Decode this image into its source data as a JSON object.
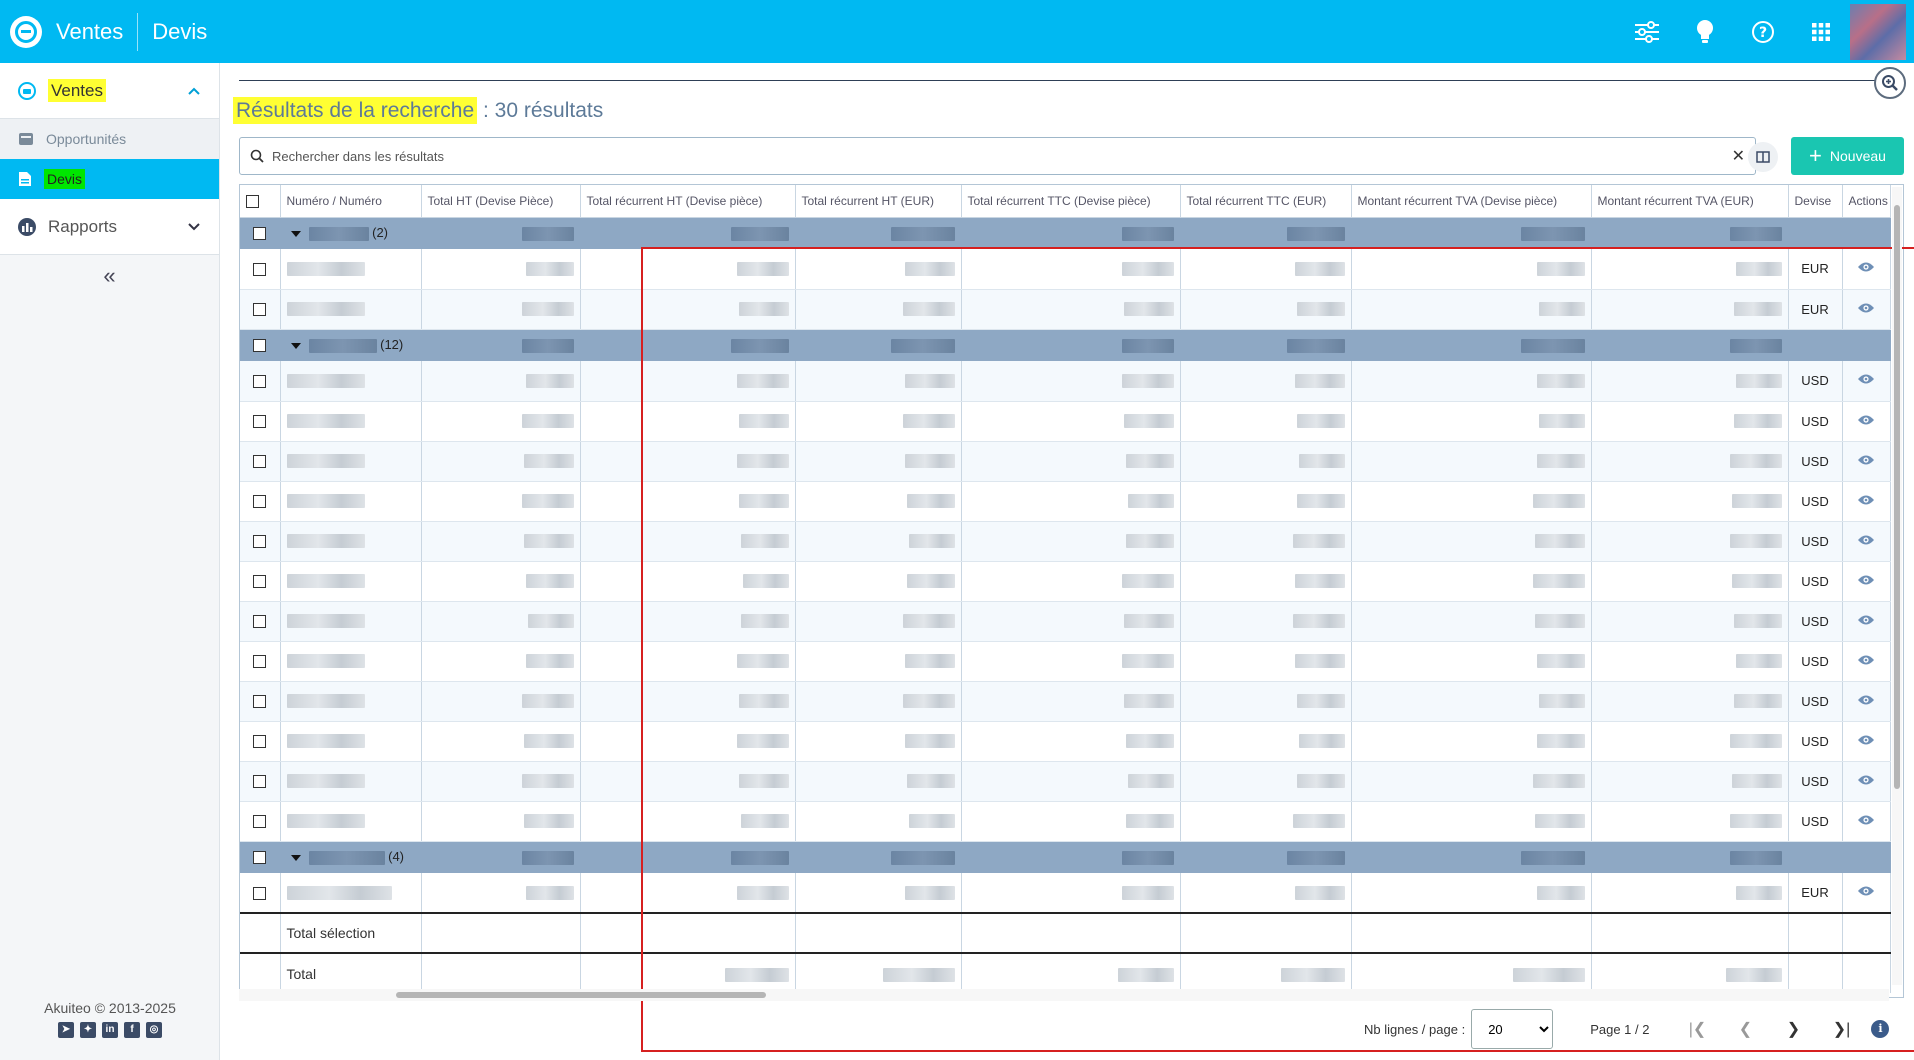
{
  "topbar": {
    "app_title": "Ventes",
    "module_title": "Devis",
    "icons": [
      "sliders-icon",
      "lightbulb-icon",
      "help-icon",
      "apps-grid-icon"
    ]
  },
  "sidebar": {
    "section_label": "Ventes",
    "items": [
      {
        "label": "Opportunités",
        "icon": "clipboard-icon",
        "active": false
      },
      {
        "label": "Devis",
        "icon": "document-icon",
        "active": true
      }
    ],
    "reports_label": "Rapports",
    "collapse_glyph": "«",
    "footer": "Akuiteo © 2013-2025",
    "socials": [
      "telegram",
      "bluesky",
      "linkedin",
      "facebook",
      "instagram"
    ]
  },
  "main": {
    "title_highlight": "Résultats de la recherche",
    "title_suffix": " : 30 résultats",
    "search_placeholder": "Rechercher dans les résultats",
    "clear_glyph": "✕",
    "new_button": "Nouveau",
    "colors": {
      "accent": "#00b9f2",
      "new_button": "#1ac6b1",
      "group_row": "#8ea8c4",
      "frame": "#d62020"
    }
  },
  "table": {
    "headers": [
      "Numéro / Numéro",
      "Total HT (Devise Pièce)",
      "Total récurrent HT (Devise pièce)",
      "Total récurrent HT (EUR)",
      "Total récurrent TTC (Devise pièce)",
      "Total récurrent TTC (EUR)",
      "Montant récurrent TVA (Devise pièce)",
      "Montant récurrent TVA (EUR)",
      "Devise",
      "Actions"
    ],
    "groups": [
      {
        "count": "(2)",
        "rows": [
          "EUR",
          "EUR"
        ]
      },
      {
        "count": "(12)",
        "rows": [
          "USD",
          "USD",
          "USD",
          "USD",
          "USD",
          "USD",
          "USD",
          "USD",
          "USD",
          "USD",
          "USD",
          "USD"
        ]
      },
      {
        "count": "(4)",
        "rows": [
          "EUR"
        ]
      }
    ],
    "total_selection_label": "Total sélection",
    "total_label": "Total"
  },
  "pager": {
    "rows_label": "Nb lignes / page :",
    "rows_value": "20",
    "page_info": "Page 1 / 2"
  }
}
